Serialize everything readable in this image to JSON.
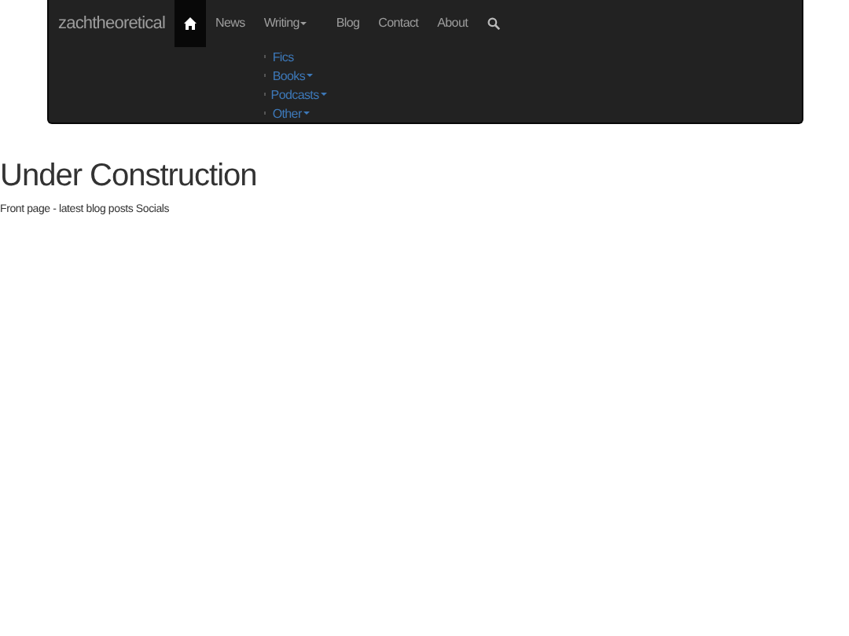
{
  "navbar": {
    "brand": "zachtheoretical",
    "items": [
      {
        "kind": "home",
        "selected": true
      },
      {
        "kind": "link",
        "label": "News",
        "selected": false
      },
      {
        "kind": "dropdown",
        "label": "Writing",
        "selected": false,
        "expanded": true,
        "children": [
          {
            "label": "Fics",
            "has_menu": false
          },
          {
            "label": "Books",
            "has_menu": true
          },
          {
            "label": "Podcasts",
            "has_menu": true
          },
          {
            "label": "Other",
            "has_menu": true
          }
        ]
      },
      {
        "kind": "link",
        "label": "Blog",
        "selected": false
      },
      {
        "kind": "link",
        "label": "Contact",
        "selected": false
      },
      {
        "kind": "link",
        "label": "About",
        "selected": false
      },
      {
        "kind": "search",
        "selected": false
      }
    ]
  },
  "heading": "Under Construction",
  "text": "Front page - latest blog posts Socials"
}
